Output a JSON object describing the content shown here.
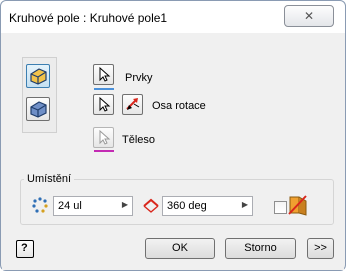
{
  "window": {
    "title": "Kruhové pole : Kruhové pole1",
    "close_glyph": "✕"
  },
  "selection": {
    "prvky_label": "Prvky",
    "osa_label": "Osa rotace",
    "teleso_label": "Těleso"
  },
  "placement": {
    "group_label": "Umístění",
    "count_value": "24 ul",
    "angle_value": "360 deg"
  },
  "footer": {
    "help_glyph": "?",
    "ok_label": "OK",
    "cancel_label": "Storno",
    "more_label": ">>"
  },
  "colors": {
    "accent_blue": "#4a90d9",
    "accent_magenta": "#c32bb3",
    "arrow_red": "#d9261c"
  }
}
